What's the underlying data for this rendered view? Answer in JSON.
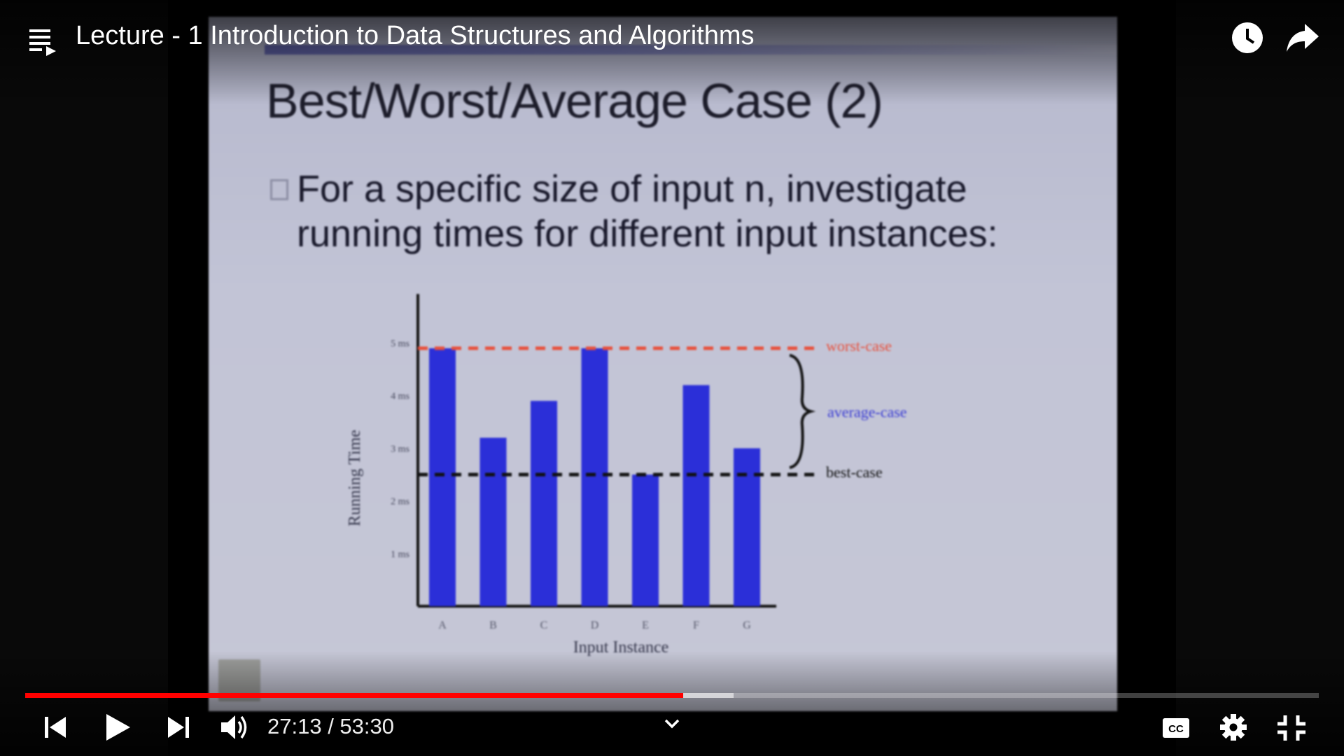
{
  "player": {
    "title": "Lecture - 1 Introduction to Data Structures and Algorithms",
    "time_display": "27:13 / 53:30",
    "progress_played": 0.5086,
    "progress_buffered": 0.5476,
    "accent_color": "#ff0000",
    "icons": {
      "playlist": "playlist-icon",
      "watch_later": "clock-icon",
      "share": "share-icon",
      "previous": "skip-previous-icon",
      "play": "play-icon",
      "next": "skip-next-icon",
      "volume": "volume-icon",
      "expand": "chevron-down-icon",
      "captions": "closed-captions-icon",
      "settings": "gear-icon",
      "exit_fullscreen": "exit-fullscreen-icon"
    }
  },
  "slide": {
    "title": "Best/Worst/Average Case (2)",
    "bullet": "For a specific size of input n, investigate running times for different input instances:"
  },
  "chart_data": {
    "type": "bar",
    "categories": [
      "A",
      "B",
      "C",
      "D",
      "E",
      "F",
      "G"
    ],
    "values": [
      4.9,
      3.2,
      3.9,
      4.9,
      2.5,
      4.2,
      3.0
    ],
    "ytick_labels": [
      "1 ms",
      "2 ms",
      "3 ms",
      "4 ms",
      "5 ms"
    ],
    "yticks": [
      1,
      2,
      3,
      4,
      5
    ],
    "ylim": [
      0,
      6
    ],
    "xlabel": "Input Instance",
    "ylabel": "Running Time",
    "bar_color": "#2b2fd8",
    "reference_lines": [
      {
        "label": "worst-case",
        "value": 4.9,
        "color": "#e8503c"
      },
      {
        "label": "best-case",
        "value": 2.5,
        "color": "#111111"
      }
    ],
    "brace_label": "average-case",
    "brace_color": "#3a3cd4",
    "grid": false
  }
}
